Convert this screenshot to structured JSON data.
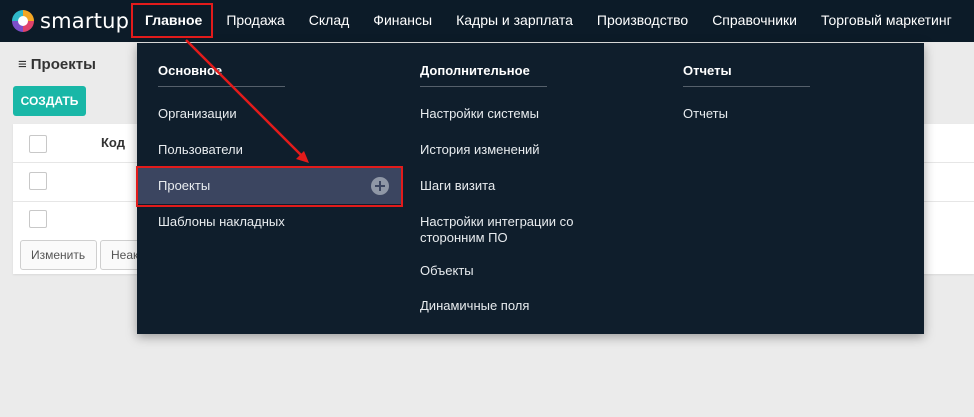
{
  "brand": {
    "name": "smartup"
  },
  "nav": {
    "items": [
      {
        "label": "Главное",
        "active": true
      },
      {
        "label": "Продажа"
      },
      {
        "label": "Склад"
      },
      {
        "label": "Финансы"
      },
      {
        "label": "Кадры и зарплата"
      },
      {
        "label": "Производство"
      },
      {
        "label": "Справочники"
      },
      {
        "label": "Торговый маркетинг"
      }
    ]
  },
  "page": {
    "title": "Проекты",
    "menu_icon": "hamburger-icon",
    "create_label": "СОЗДАТЬ",
    "table": {
      "columns": [
        "Код"
      ]
    },
    "buttons": [
      "Изменить",
      "Неак"
    ]
  },
  "menu": {
    "columns": [
      {
        "title": "Основное",
        "items": [
          "Организации",
          "Пользователи",
          "Проекты",
          "Шаблоны накладных"
        ]
      },
      {
        "title": "Дополнительное",
        "items": [
          "Настройки системы",
          "История изменений",
          "Шаги визита",
          "Настройки интеграции со сторонним ПО",
          "Объекты",
          "Динамичные поля"
        ]
      },
      {
        "title": "Отчеты",
        "items": [
          "Отчеты"
        ]
      }
    ],
    "selected": "Проекты",
    "selected_action_icon": "plus-circle-icon"
  },
  "annotation": {
    "highlight_color": "#e21b1b"
  },
  "colors": {
    "topbar": "#0c1b28",
    "menu_bg": "#0f1e2c",
    "selected_row": "#3b4560",
    "accent": "#19b7a7"
  }
}
